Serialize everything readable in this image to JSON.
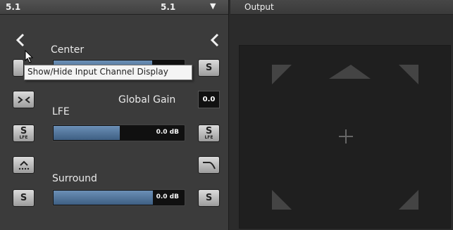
{
  "input_panel": {
    "format_left": "5.1",
    "format_right": "5.1",
    "dropdown_icon": "triangle-down-icon",
    "collapse_left_icon": "chevron-left-icon",
    "collapse_right_icon": "chevron-left-icon",
    "center": {
      "label": "Center",
      "solo_icon": "s-icon",
      "solo_label": "S"
    },
    "tooltip": "Show/Hide Input Channel Display",
    "global_gain": {
      "label": "Global Gain",
      "value": "0.0"
    },
    "lfe": {
      "label": "LFE",
      "value": "0.0 dB",
      "level_fraction": 0.5,
      "solo_label": "S",
      "solo_sub": "LFE"
    },
    "surround": {
      "label": "Surround",
      "value": "0.0 dB",
      "level_fraction": 0.75,
      "solo_label": "S"
    },
    "icons": {
      "mix_icon": "collapse-arrows-icon",
      "front_icon": "arrow-up-dots-icon",
      "curve_icon": "curve-icon"
    }
  },
  "output_panel": {
    "title": "Output",
    "speakers": [
      "front-left",
      "center",
      "front-right",
      "surround-left",
      "surround-right"
    ],
    "center_marker": "crosshair-icon"
  },
  "colors": {
    "fill": "#4f7297",
    "panel": "#3b3b3b",
    "stage": "#1f1f1f"
  }
}
